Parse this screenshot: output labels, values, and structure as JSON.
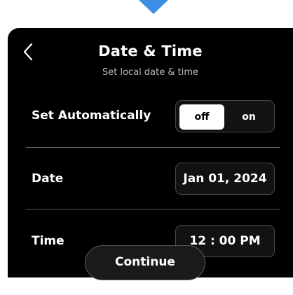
{
  "header": {
    "back_icon": "chevron-left-icon",
    "title": "Date & Time",
    "subtitle": "Set local date & time"
  },
  "set_automatically": {
    "label": "Set Automatically",
    "options": [
      "off",
      "on"
    ],
    "selected": "off"
  },
  "date": {
    "label": "Date",
    "value": "Jan 01, 2024"
  },
  "time": {
    "label": "Time",
    "value": "12 : 00 PM"
  },
  "footer": {
    "continue_label": "Continue"
  },
  "colors": {
    "accent_pointer": "#3d8fe6",
    "panel_background": "#000000",
    "selected_segment": "#ffffff"
  }
}
